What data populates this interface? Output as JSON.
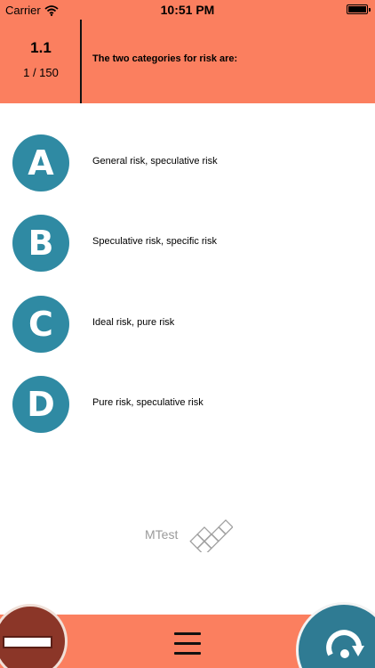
{
  "status_bar": {
    "carrier": "Carrier",
    "time": "10:51 PM"
  },
  "header": {
    "question_number": "1.1",
    "progress": "1 / 150",
    "question": "The two categories for risk are:"
  },
  "answers": [
    {
      "letter": "A",
      "text": "General risk, speculative risk"
    },
    {
      "letter": "B",
      "text": "Speculative risk, specific risk"
    },
    {
      "letter": "C",
      "text": "Ideal risk, pure risk"
    },
    {
      "letter": "D",
      "text": "Pure risk, speculative risk"
    }
  ],
  "logo": {
    "text": "MTest"
  },
  "colors": {
    "header_bg": "#fb7f5f",
    "answer_circle": "#2f8aa3",
    "stop_button": "#8b3628",
    "redo_button": "#2f7b93"
  },
  "icons": {
    "wifi": "wifi-icon",
    "battery": "battery-icon",
    "menu": "hamburger-menu-icon",
    "stop": "no-entry-icon",
    "redo": "rotate-icon"
  }
}
